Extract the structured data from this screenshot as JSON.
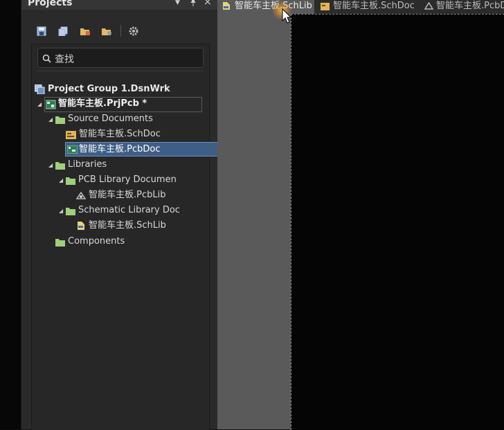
{
  "panel": {
    "title": "Projects",
    "header_buttons": {
      "menu": "▼",
      "pin": "📌",
      "close": "×"
    }
  },
  "toolbar": {
    "icons": [
      "save-icon",
      "copy-icon",
      "open-folder-icon",
      "folder-settings-icon",
      "gear-icon"
    ]
  },
  "search": {
    "placeholder": "查找"
  },
  "tree": {
    "group": "Project Group 1.DsnWrk",
    "project": "智能车主板.PrjPcb *",
    "source_documents": "Source Documents",
    "schdoc": "智能车主板.SchDoc",
    "pcbdoc": "智能车主板.PcbDoc",
    "libraries": "Libraries",
    "pcb_library": "PCB Library Documen",
    "pcblib": "智能车主板.PcbLib",
    "schematic_library": "Schematic Library Doc",
    "schlib": "智能车主板.SchLib",
    "components": "Components"
  },
  "tabs": [
    {
      "label": "智能车主板.SchLib",
      "active": true
    },
    {
      "label": "智能车主板.SchDoc",
      "active": false
    },
    {
      "label": "智能车主板.PcbDoc",
      "active": false
    }
  ],
  "colors": {
    "selection": "#3f5e85",
    "folder": "#9fcf7a",
    "canvas": "#050505"
  }
}
